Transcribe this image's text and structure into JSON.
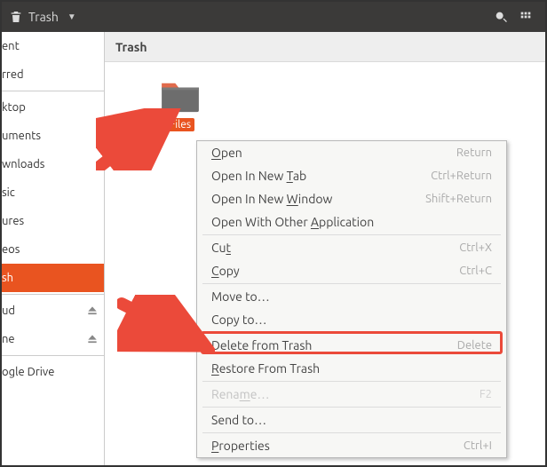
{
  "topbar": {
    "title": "Trash"
  },
  "pathbar": {
    "title": "Trash"
  },
  "sidebar": {
    "items": [
      {
        "label": "ent"
      },
      {
        "label": "rred"
      },
      {
        "label": "ktop"
      },
      {
        "label": "uments"
      },
      {
        "label": "wnloads"
      },
      {
        "label": "sic"
      },
      {
        "label": "ures"
      },
      {
        "label": "eos"
      },
      {
        "label": "sh"
      },
      {
        "label": "ud"
      },
      {
        "label": "ne"
      },
      {
        "label": "ogle Drive"
      }
    ]
  },
  "folder": {
    "name": "Files"
  },
  "context_menu": {
    "open": {
      "label": "Open",
      "accel": "Return",
      "m": "O"
    },
    "open_tab": {
      "pre": "Open In New ",
      "m": "T",
      "post": "ab",
      "accel": "Ctrl+Return"
    },
    "open_win": {
      "pre": "Open In New ",
      "m": "W",
      "post": "indow",
      "accel": "Shift+Return"
    },
    "open_with": {
      "pre": "Open With Other ",
      "m": "A",
      "post": "pplication"
    },
    "cut": {
      "pre": "Cu",
      "m": "t",
      "accel": "Ctrl+X"
    },
    "copy": {
      "pre": "",
      "m": "C",
      "post": "opy",
      "accel": "Ctrl+C"
    },
    "move_to": {
      "label": "Move to…"
    },
    "copy_to": {
      "label": "Copy to…"
    },
    "delete_trash": {
      "pre": "",
      "m": "D",
      "post": "elete from Trash",
      "accel": "Delete"
    },
    "restore_trash": {
      "pre": "",
      "m": "R",
      "post": "estore From Trash"
    },
    "rename": {
      "label": "Rena",
      "m": "m",
      "post": "e…",
      "accel": "F2"
    },
    "send_to": {
      "label": "Send to…"
    },
    "properties": {
      "pre": "",
      "m": "P",
      "post": "roperties",
      "accel": "Ctrl+I"
    }
  }
}
